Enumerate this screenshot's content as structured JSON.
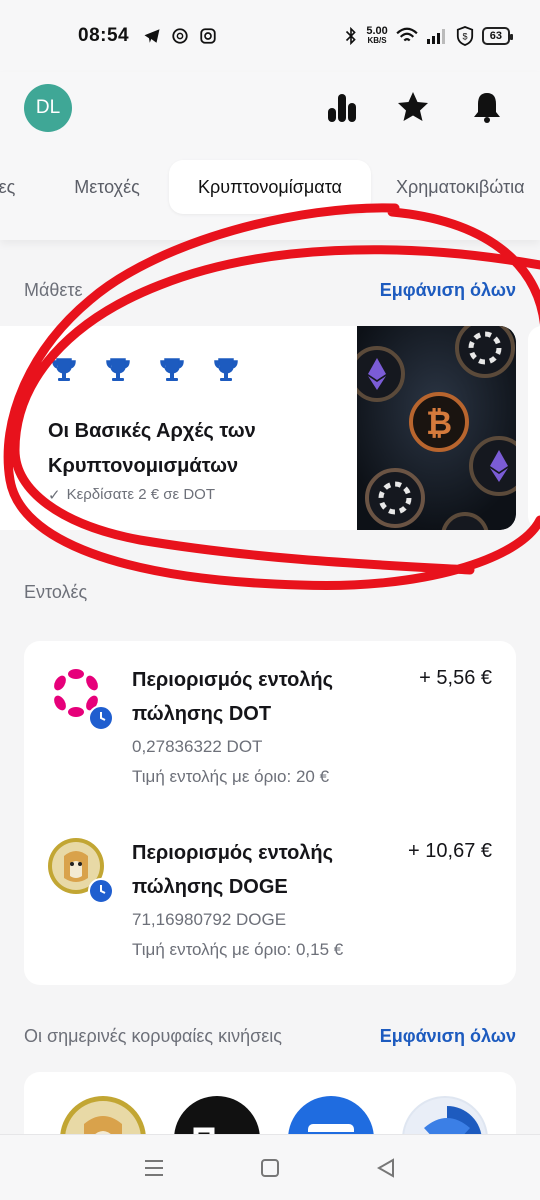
{
  "status_bar": {
    "time": "08:54",
    "net_speed_value": "5.00",
    "net_speed_unit": "KB/S",
    "battery": "63",
    "icons": [
      "telegram-icon",
      "threads-icon",
      "instagram-icon",
      "bluetooth-icon",
      "wifi-icon",
      "signal-icon",
      "shield-icon",
      "battery-icon"
    ]
  },
  "header": {
    "avatar_initials": "DL",
    "icons": [
      "stats-icon",
      "star-icon",
      "bell-icon"
    ]
  },
  "tabs": [
    {
      "label": "ες",
      "active": false
    },
    {
      "label": "Μετοχές",
      "active": false
    },
    {
      "label": "Κρυπτονομίσματα",
      "active": true
    },
    {
      "label": "Χρηματοκιβώτια",
      "active": false
    }
  ],
  "learn": {
    "section_title": "Μάθετε",
    "show_all": "Εμφάνιση όλων",
    "card_title": "Οι Βασικές Αρχές των Κρυπτονομισμάτων",
    "reward": "Κερδίσατε 2 € σε DOT",
    "trophy_count": 4
  },
  "orders": {
    "section_title": "Εντολές",
    "items": [
      {
        "title": "Περιορισμός εντολής πώλησης DOT",
        "amount": "+ 5,56 €",
        "quantity": "0,27836322 DOT",
        "limit": "Τιμή εντολής με όριο: 20 €",
        "coin": "polkadot-logo"
      },
      {
        "title": "Περιορισμός εντολής πώλησης DOGE",
        "amount": "+ 10,67 €",
        "quantity": "71,16980792 DOGE",
        "limit": "Τιμή εντολής με όριο: 0,15 €",
        "coin": "dogecoin-logo"
      }
    ]
  },
  "movers": {
    "section_title": "Οι σημερινές κορυφαίες κινήσεις",
    "show_all": "Εμφάνιση όλων"
  },
  "colors": {
    "accent_blue": "#1d5bbf",
    "avatar_teal": "#3fa796",
    "annotation_red": "#e8121c",
    "polkadot_pink": "#e6007a"
  }
}
